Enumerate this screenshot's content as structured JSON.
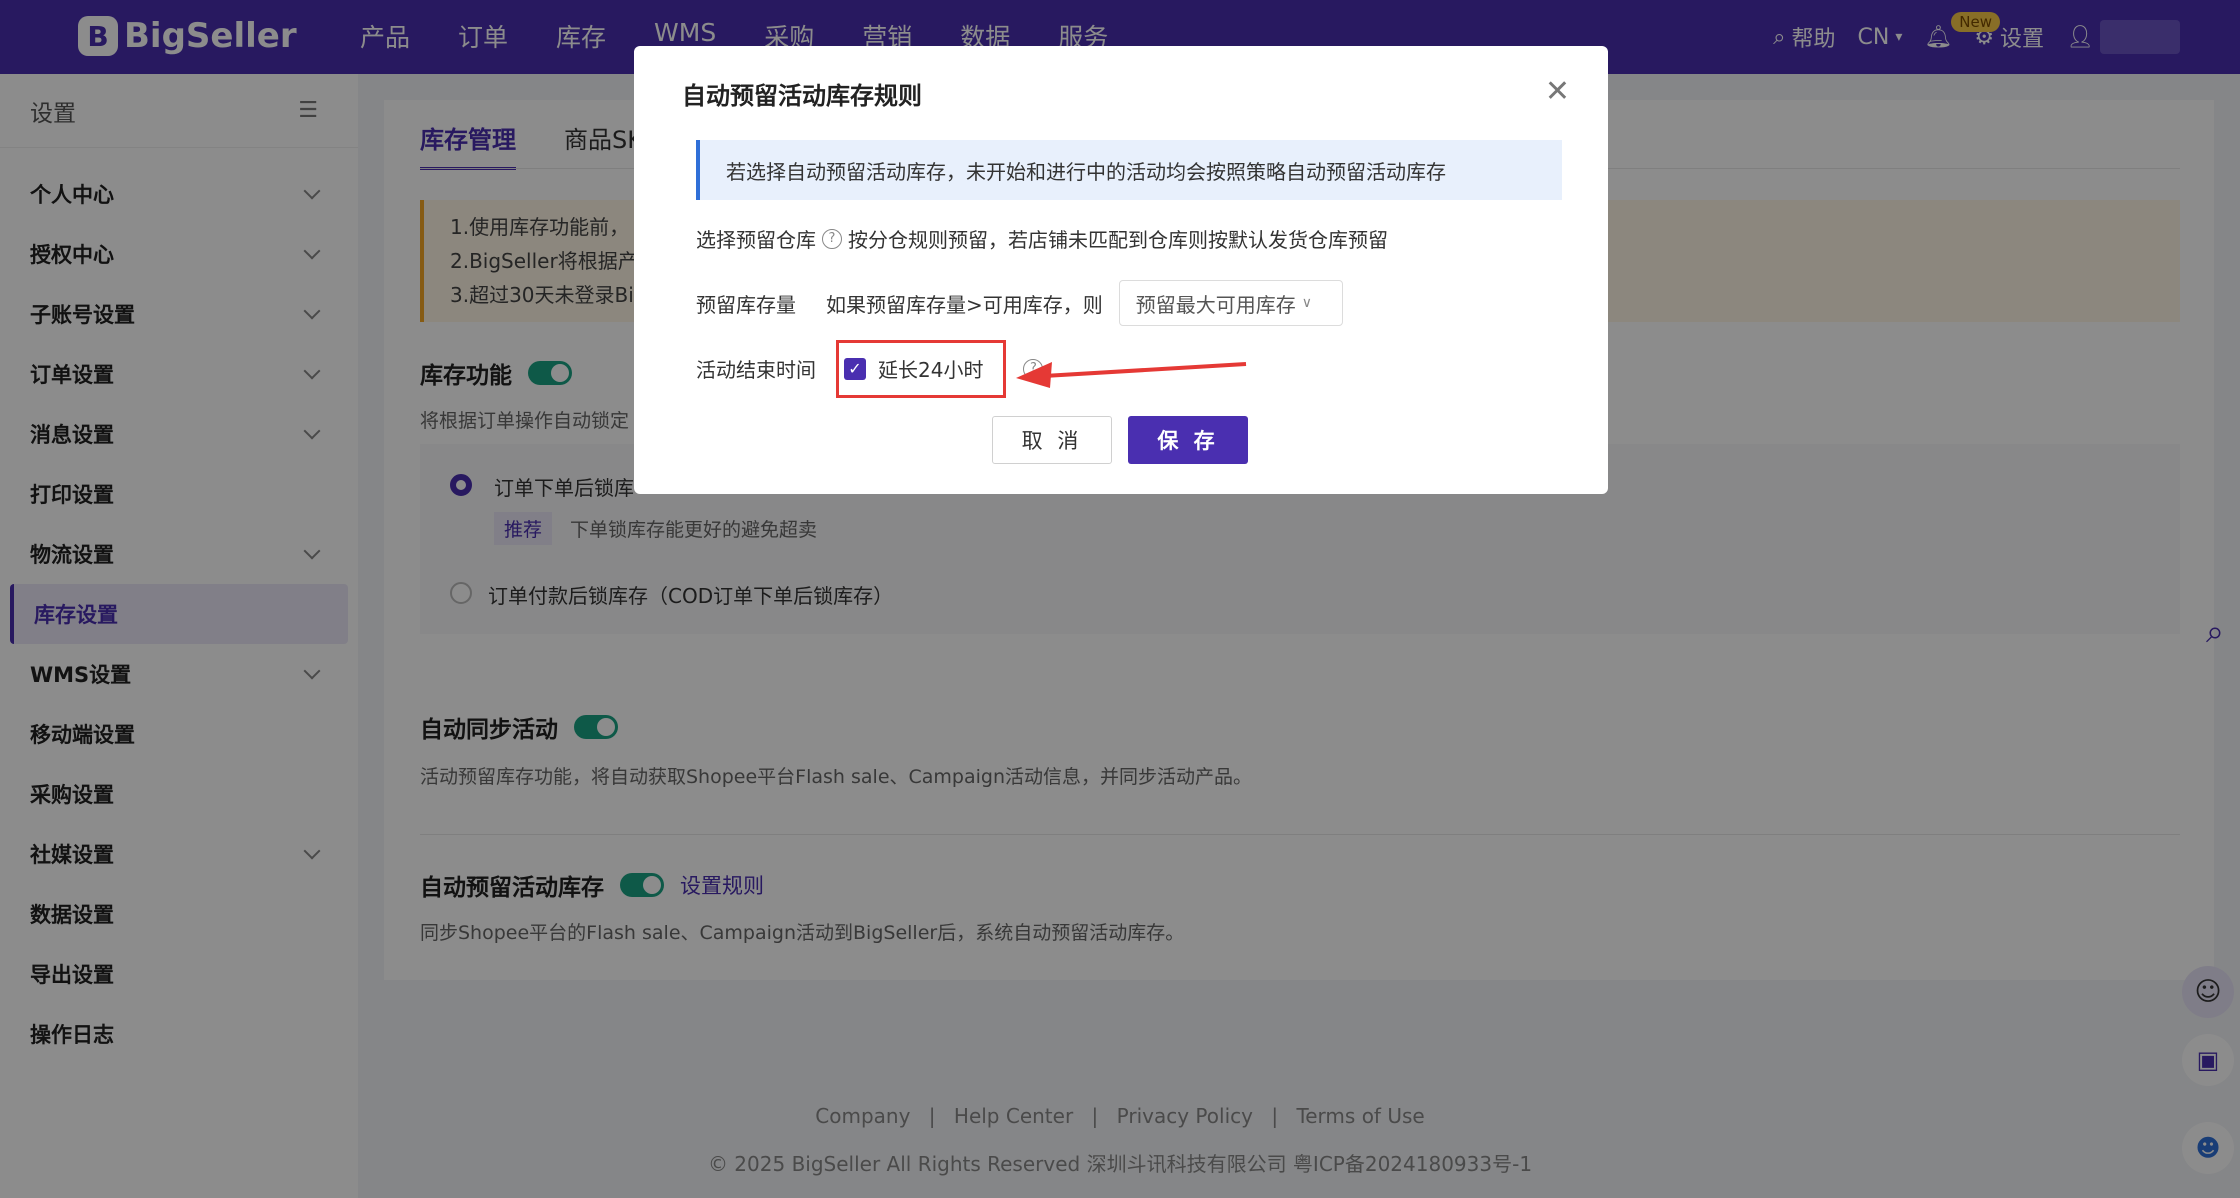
{
  "brand": {
    "name": "BigSeller"
  },
  "nav": {
    "items": [
      "产品",
      "订单",
      "库存",
      "WMS",
      "采购",
      "营销",
      "数据",
      "服务"
    ],
    "help": "帮助",
    "lang": "CN",
    "new_badge": "New",
    "settings": "设置"
  },
  "sidebar": {
    "header": "设置",
    "items": [
      {
        "label": "个人中心",
        "expand": true
      },
      {
        "label": "授权中心",
        "expand": true
      },
      {
        "label": "子账号设置",
        "expand": true
      },
      {
        "label": "订单设置",
        "expand": true
      },
      {
        "label": "消息设置",
        "expand": true
      },
      {
        "label": "打印设置",
        "expand": false
      },
      {
        "label": "物流设置",
        "expand": true
      },
      {
        "label": "库存设置",
        "expand": false,
        "active": true
      },
      {
        "label": "WMS设置",
        "expand": true
      },
      {
        "label": "移动端设置",
        "expand": false
      },
      {
        "label": "采购设置",
        "expand": false
      },
      {
        "label": "社媒设置",
        "expand": true
      },
      {
        "label": "数据设置",
        "expand": false
      },
      {
        "label": "导出设置",
        "expand": false
      },
      {
        "label": "操作日志",
        "expand": false
      }
    ]
  },
  "main": {
    "tabs": [
      "库存管理",
      "商品SK"
    ],
    "notice_lines": [
      "1.使用库存功能前，",
      "2.BigSeller将根据产",
      "3.超过30天未登录Bi"
    ],
    "stock_func_title": "库存功能",
    "stock_func_desc": "将根据订单操作自动锁定",
    "option1": "订单下单后锁库",
    "recommend_tag": "推荐",
    "recommend_desc": "下单锁库存能更好的避免超卖",
    "option2": "订单付款后锁库存（COD订单下单后锁库存）",
    "sync_title": "自动同步活动",
    "sync_desc": "活动预留库存功能，将自动获取Shopee平台Flash sale、Campaign活动信息，并同步活动产品。",
    "reserve_title": "自动预留活动库存",
    "reserve_link": "设置规则",
    "reserve_desc": "同步Shopee平台的Flash sale、Campaign活动到BigSeller后，系统自动预留活动库存。"
  },
  "footer": {
    "links": [
      "Company",
      "Help Center",
      "Privacy Policy",
      "Terms of Use"
    ],
    "copyright": "© 2025 BigSeller All Rights Reserved   深圳斗讯科技有限公司   粤ICP备2024180933号-1"
  },
  "modal": {
    "title": "自动预留活动库存规则",
    "info": "若选择自动预留活动库存，未开始和进行中的活动均会按照策略自动预留活动库存",
    "warehouse_label": "选择预留仓库",
    "warehouse_text": "按分仓规则预留，若店铺未匹配到仓库则按默认发货仓库预留",
    "qty_label": "预留库存量",
    "qty_text": "如果预留库存量>可用库存，则",
    "qty_select": "预留最大可用库存",
    "end_label": "活动结束时间",
    "extend_label": "延长24小时",
    "extend_checked": true,
    "cancel": "取 消",
    "save": "保 存"
  },
  "colors": {
    "brand": "#4a2fb0",
    "toggle": "#1aa383",
    "highlight": "#e53935"
  }
}
